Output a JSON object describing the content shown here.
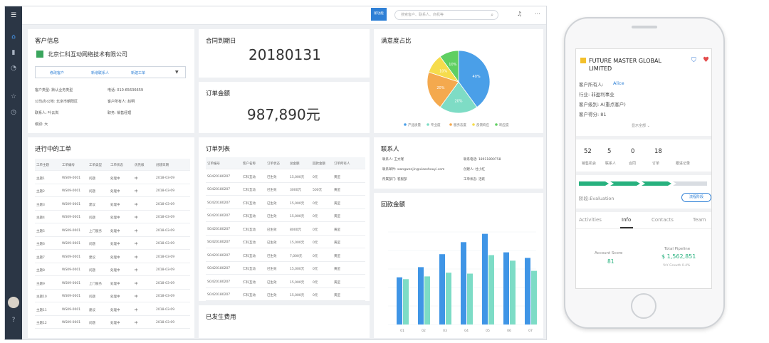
{
  "topbar": {
    "badge": "新功能",
    "search_placeholder": "搜索客户、联系人、商机等"
  },
  "customer": {
    "title": "客户信息",
    "company": "北京仁科互动网络技术有限公司",
    "buttons": [
      "修改客户",
      "新增联系人",
      "新建工单"
    ],
    "fields": [
      [
        "客户类型: 默认业务类型",
        "电话: 010-65636659"
      ],
      [
        "公司/办公地: 北京市朝阳区",
        "客户所有人: 赵明"
      ],
      [
        "联系人: 叶云岚",
        "职务: 销售经理"
      ],
      [
        "级别: 大",
        ""
      ]
    ]
  },
  "contract": {
    "title": "合同到期日",
    "value": "20180131"
  },
  "amount": {
    "title": "订单金额",
    "value": "987,890元"
  },
  "satisfaction": {
    "title": "满意度占比",
    "slices": [
      {
        "label": "产品质量",
        "value": 40,
        "color": "#4a9fe8",
        "text": "40%"
      },
      {
        "label": "专业度",
        "value": 20,
        "color": "#7edcc5",
        "text": "20%"
      },
      {
        "label": "服务态度",
        "value": 20,
        "color": "#f4a94e",
        "text": "20%"
      },
      {
        "label": "反馈响应",
        "value": 10,
        "color": "#f6dc4c",
        "text": "10%"
      },
      {
        "label": "响应度",
        "value": 10,
        "color": "#5fcf62",
        "text": "10%"
      }
    ]
  },
  "workorders": {
    "title": "进行中的工单",
    "headers": [
      "工单主题",
      "工单编号",
      "工单类型",
      "工单状态",
      "优先级",
      "创建日期"
    ],
    "rows": [
      [
        "主题1",
        "WS09-0001",
        "问题",
        "处理中",
        "中",
        "2018-03-09"
      ],
      [
        "主题2",
        "WS09-0001",
        "问题",
        "处理中",
        "中",
        "2018-03-09"
      ],
      [
        "主题3",
        "WS09-0001",
        "建议",
        "处理中",
        "中",
        "2018-03-09"
      ],
      [
        "主题4",
        "WS09-0001",
        "问题",
        "处理中",
        "中",
        "2018-03-09"
      ],
      [
        "主题5",
        "WS09-0001",
        "上门服务",
        "处理中",
        "中",
        "2018-03-09"
      ],
      [
        "主题6",
        "WS09-0001",
        "问题",
        "处理中",
        "中",
        "2018-03-09"
      ],
      [
        "主题7",
        "WS09-0001",
        "建议",
        "处理中",
        "中",
        "2018-03-09"
      ],
      [
        "主题8",
        "WS09-0001",
        "问题",
        "处理中",
        "中",
        "2018-03-09"
      ],
      [
        "主题9",
        "WS09-0001",
        "上门服务",
        "处理中",
        "中",
        "2018-03-09"
      ],
      [
        "主题10",
        "WS09-0001",
        "问题",
        "处理中",
        "中",
        "2018-03-09"
      ],
      [
        "主题11",
        "WS09-0001",
        "建议",
        "处理中",
        "中",
        "2018-03-09"
      ],
      [
        "主题12",
        "WS09-0001",
        "问题",
        "处理中",
        "中",
        "2018-03-09"
      ]
    ]
  },
  "orders": {
    "title": "订单列表",
    "headers": [
      "订单编号",
      "客户名称",
      "订单状态",
      "总金额",
      "回款金额",
      "订单所有人"
    ],
    "rows": [
      [
        "SO420180207",
        "仁科互动",
        "已生效",
        "15,000元",
        "0元",
        "黄罡"
      ],
      [
        "SO420180207",
        "仁科互动",
        "已生效",
        "3000元",
        "500元",
        "黄罡"
      ],
      [
        "SO420180207",
        "仁科互动",
        "已生效",
        "15,000元",
        "0元",
        "黄罡"
      ],
      [
        "SO420180207",
        "仁科互动",
        "已生效",
        "15,000元",
        "0元",
        "黄罡"
      ],
      [
        "SO420180207",
        "仁科互动",
        "已生效",
        "8000元",
        "0元",
        "黄罡"
      ],
      [
        "SO420180207",
        "仁科互动",
        "已生效",
        "15,000元",
        "0元",
        "黄罡"
      ],
      [
        "SO420180207",
        "仁科互动",
        "已生效",
        "7,000元",
        "0元",
        "黄罡"
      ],
      [
        "SO420180207",
        "仁科互动",
        "已生效",
        "15,000元",
        "0元",
        "黄罡"
      ],
      [
        "SO420180207",
        "仁科互动",
        "已生效",
        "15,000元",
        "0元",
        "黄罡"
      ],
      [
        "SO420180207",
        "仁科互动",
        "已生效",
        "15,000元",
        "0元",
        "黄罡"
      ]
    ]
  },
  "expenses": {
    "title": "已发生费用"
  },
  "contact": {
    "title": "联系人",
    "fields": [
      [
        "联系人: 王文瑾",
        "联系电话: 18911890758"
      ],
      [
        "联系邮件: wangwenjin@xiaoshouyi.com",
        "创建人: 杜小红"
      ],
      [
        "所属部门: 客服部",
        "工单状态: 活跃"
      ]
    ]
  },
  "collection": {
    "title": "回款金额",
    "x": [
      "01",
      "02",
      "03",
      "04",
      "05",
      "06",
      "07"
    ],
    "series": [
      {
        "color": "#3f95e6",
        "values": [
          5.1,
          6.2,
          7.6,
          8.9,
          9.8,
          7.8,
          7.2
        ]
      },
      {
        "color": "#7ddcc6",
        "values": [
          4.9,
          5.2,
          5.6,
          5.5,
          7.5,
          6.9,
          5.8
        ]
      }
    ]
  },
  "phone": {
    "company": "FUTURE MASTER GLOBAL LIMITED",
    "owner_label": "客户所有人:",
    "owner": "Alice",
    "industry": "行业:  非盈利事业",
    "level": "客户级别:  A(重点客户)",
    "score": "客户得分:  81",
    "show_all": "显示全部",
    "stats": [
      {
        "value": "52",
        "label": "销售机会"
      },
      {
        "value": "5",
        "label": "联系人"
      },
      {
        "value": "0",
        "label": "合同"
      },
      {
        "value": "18",
        "label": "订单"
      },
      {
        "value": "",
        "label": "跟进记录"
      }
    ],
    "stage": "阶段:Evaluation",
    "stage_btn": "流程阶段",
    "tabs": [
      "Activities",
      "Info",
      "Contacts",
      "Team"
    ],
    "account_score_label": "Account Score",
    "account_score": "81",
    "pipeline_label": "Total Pipeline",
    "pipeline": "$ 1,562,851",
    "growth": "YoY Growth 0.4%"
  }
}
